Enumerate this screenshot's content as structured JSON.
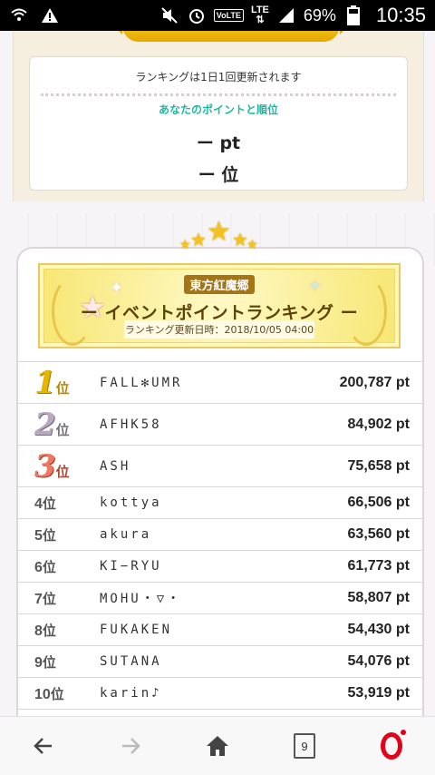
{
  "status_bar": {
    "battery": "69%",
    "time": "10:35",
    "network": "LTE",
    "volte": "VoLTE"
  },
  "info_card": {
    "update_note": "ランキングは1日1回更新されます",
    "subtitle": "あなたのポイントと順位",
    "points": "ー pt",
    "rank": "ー 位"
  },
  "banner": {
    "event_name": "東方紅魔郷",
    "title": "ー イベントポイントランキング ー",
    "updated": "ランキング更新日時：2018/10/05 04:00"
  },
  "ranking": [
    {
      "rank": "1",
      "suffix": "位",
      "name": "FALL✻UMR",
      "points": "200,787 pt"
    },
    {
      "rank": "2",
      "suffix": "位",
      "name": "AFHK58",
      "points": "84,902 pt"
    },
    {
      "rank": "3",
      "suffix": "位",
      "name": "ASH",
      "points": "75,658 pt"
    },
    {
      "rank": "4",
      "suffix": "位",
      "name": "kottya",
      "points": "66,506 pt"
    },
    {
      "rank": "5",
      "suffix": "位",
      "name": "akura",
      "points": "63,560 pt"
    },
    {
      "rank": "6",
      "suffix": "位",
      "name": "KI−RYU",
      "points": "61,773 pt"
    },
    {
      "rank": "7",
      "suffix": "位",
      "name": "MOHU・▽・",
      "points": "58,807 pt"
    },
    {
      "rank": "8",
      "suffix": "位",
      "name": "FUKAKEN",
      "points": "54,430 pt"
    },
    {
      "rank": "9",
      "suffix": "位",
      "name": "SUTANA",
      "points": "54,076 pt"
    },
    {
      "rank": "10",
      "suffix": "位",
      "name": "karin♪",
      "points": "53,919 pt"
    }
  ],
  "nav": {
    "tab_count": "9",
    "icons": [
      "back-arrow-icon",
      "forward-arrow-icon",
      "home-icon",
      "tabs-icon",
      "opera-menu-icon"
    ]
  },
  "colors": {
    "accent_teal": "#1cb8a6",
    "gold": "#e5b500",
    "silver": "#b9a9bf",
    "bronze": "#ee7861",
    "opera_red": "#e3001b"
  }
}
